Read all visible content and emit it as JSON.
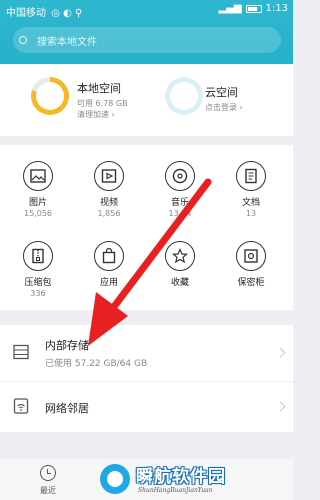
{
  "status_bar": {
    "carrier": "中国移动",
    "time": "1:13"
  },
  "search": {
    "placeholder": "搜索本地文件"
  },
  "storage": {
    "local": {
      "title": "本地空间",
      "available": "可用 6.78 GB",
      "action": "清理加速 ›",
      "used_fraction": 0.8
    },
    "cloud": {
      "title": "云空间",
      "action": "点击登录 ›"
    }
  },
  "categories": [
    {
      "label": "图片",
      "count": "15,056",
      "icon": "image-icon"
    },
    {
      "label": "视频",
      "count": "1,856",
      "icon": "video-icon"
    },
    {
      "label": "音乐",
      "count": "13,64",
      "icon": "music-icon"
    },
    {
      "label": "文档",
      "count": "13",
      "icon": "document-icon"
    },
    {
      "label": "压缩包",
      "count": "336",
      "icon": "archive-icon"
    },
    {
      "label": "应用",
      "count": "",
      "icon": "app-bag-icon"
    },
    {
      "label": "收藏",
      "count": "",
      "icon": "favorite-star-icon"
    },
    {
      "label": "保密柜",
      "count": "",
      "icon": "safe-icon"
    }
  ],
  "internal_storage": {
    "title": "内部存储",
    "usage": "已使用 57.22 GB/64 GB"
  },
  "network": {
    "title": "网络邻居"
  },
  "bottom_nav": {
    "recent": "最近"
  },
  "watermark": {
    "title": "瞬航软件园",
    "subtitle": "ShunHangRuanJianYuan"
  },
  "colors": {
    "header": "#2bb3cc",
    "local_ring": "#f5b928",
    "cloud_ring": "#dceef8",
    "annotation_arrow": "#e8201f"
  }
}
